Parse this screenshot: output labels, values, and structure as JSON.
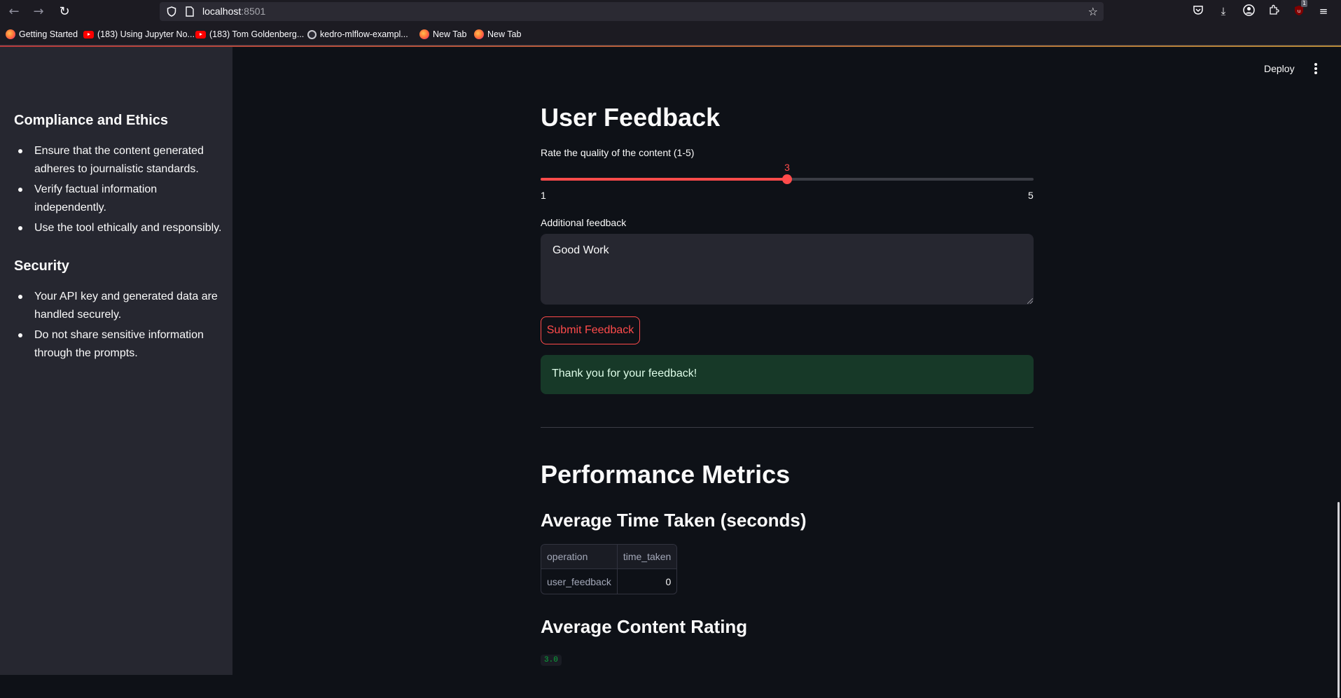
{
  "browser": {
    "url_host": "localhost",
    "url_port": ":8501",
    "bookmarks": [
      {
        "label": "Getting Started",
        "icon": "firefox-icon"
      },
      {
        "label": "(183) Using Jupyter No...",
        "icon": "youtube-icon"
      },
      {
        "label": "(183) Tom Goldenberg...",
        "icon": "youtube-icon"
      },
      {
        "label": "kedro-mlflow-exampl...",
        "icon": "github-icon"
      },
      {
        "label": "New Tab",
        "icon": "firefox-icon"
      },
      {
        "label": "New Tab",
        "icon": "firefox-icon"
      }
    ],
    "extension_badge": "1"
  },
  "sidebar": {
    "sections": [
      {
        "heading": "Compliance and Ethics",
        "items": [
          "Ensure that the content generated adheres to journalistic standards.",
          "Verify factual information independently.",
          "Use the tool ethically and responsibly."
        ]
      },
      {
        "heading": "Security",
        "items": [
          "Your API key and generated data are handled securely.",
          "Do not share sensitive information through the prompts."
        ]
      }
    ]
  },
  "header": {
    "deploy_label": "Deploy"
  },
  "feedback": {
    "title": "User Feedback",
    "slider_label": "Rate the quality of the content (1-5)",
    "slider_value": "3",
    "slider_min": "1",
    "slider_max": "5",
    "textarea_label": "Additional feedback",
    "textarea_value": "Good Work",
    "submit_label": "Submit Feedback",
    "success_message": "Thank you for your feedback!"
  },
  "metrics": {
    "title": "Performance Metrics",
    "time_title": "Average Time Taken (seconds)",
    "table": {
      "columns": [
        "operation",
        "time_taken"
      ],
      "rows": [
        [
          "user_feedback",
          "0"
        ]
      ]
    },
    "rating_title": "Average Content Rating",
    "rating_value": "3.0"
  },
  "colors": {
    "accent": "#ff4b4b",
    "background": "#0e1117",
    "sidebar": "#262730",
    "success_bg": "#173928"
  }
}
